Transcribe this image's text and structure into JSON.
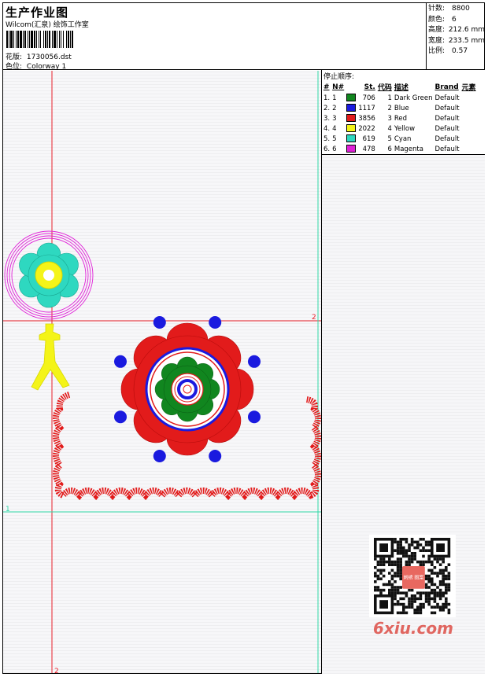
{
  "header": {
    "title": "生产作业图",
    "company": "Wilcom(汇泉) 绘饰工作室",
    "design_label": "花版:",
    "design_file": "1730056.dst",
    "color_label": "色位:",
    "colorway": "Colorway 1"
  },
  "stats": [
    {
      "label": "针数:",
      "value": "8800"
    },
    {
      "label": "颜色:",
      "value": "6"
    },
    {
      "label": "高度:",
      "value": "212.6 mm"
    },
    {
      "label": "宽度:",
      "value": "233.5 mm"
    },
    {
      "label": "比例:",
      "value": "0.57"
    }
  ],
  "stop_sequence": {
    "title": "停止顺序:",
    "columns": [
      "#",
      "N#",
      "St.",
      "代码",
      "描述",
      "Brand",
      "元素"
    ],
    "rows": [
      {
        "idx": "1.",
        "n": "1",
        "color": "#11861f",
        "st": "706",
        "code": "1",
        "desc": "Dark Green",
        "brand": "Default"
      },
      {
        "idx": "2.",
        "n": "2",
        "color": "#1a1adf",
        "st": "1117",
        "code": "2",
        "desc": "Blue",
        "brand": "Default"
      },
      {
        "idx": "3.",
        "n": "3",
        "color": "#e21b1b",
        "st": "3856",
        "code": "3",
        "desc": "Red",
        "brand": "Default"
      },
      {
        "idx": "4.",
        "n": "4",
        "color": "#f4f418",
        "st": "2022",
        "code": "4",
        "desc": "Yellow",
        "brand": "Default"
      },
      {
        "idx": "5.",
        "n": "5",
        "color": "#2ed8c0",
        "st": "619",
        "code": "5",
        "desc": "Cyan",
        "brand": "Default"
      },
      {
        "idx": "6.",
        "n": "6",
        "color": "#e020d8",
        "st": "478",
        "code": "6",
        "desc": "Magenta",
        "brand": "Default"
      }
    ]
  },
  "guides": {
    "h_label": "2",
    "v_label": "2",
    "left_label": "1"
  },
  "watermark": "6xiu.com",
  "qr_badge": "刺绣 图案",
  "colors": {
    "red": "#e21b1b",
    "blue": "#1a1adf",
    "green": "#11861f",
    "yellow": "#f4f418",
    "cyan": "#2ed8c0",
    "magenta": "#e020d8",
    "guide_red": "#e8202a",
    "guide_cyan": "#30d8a8"
  }
}
